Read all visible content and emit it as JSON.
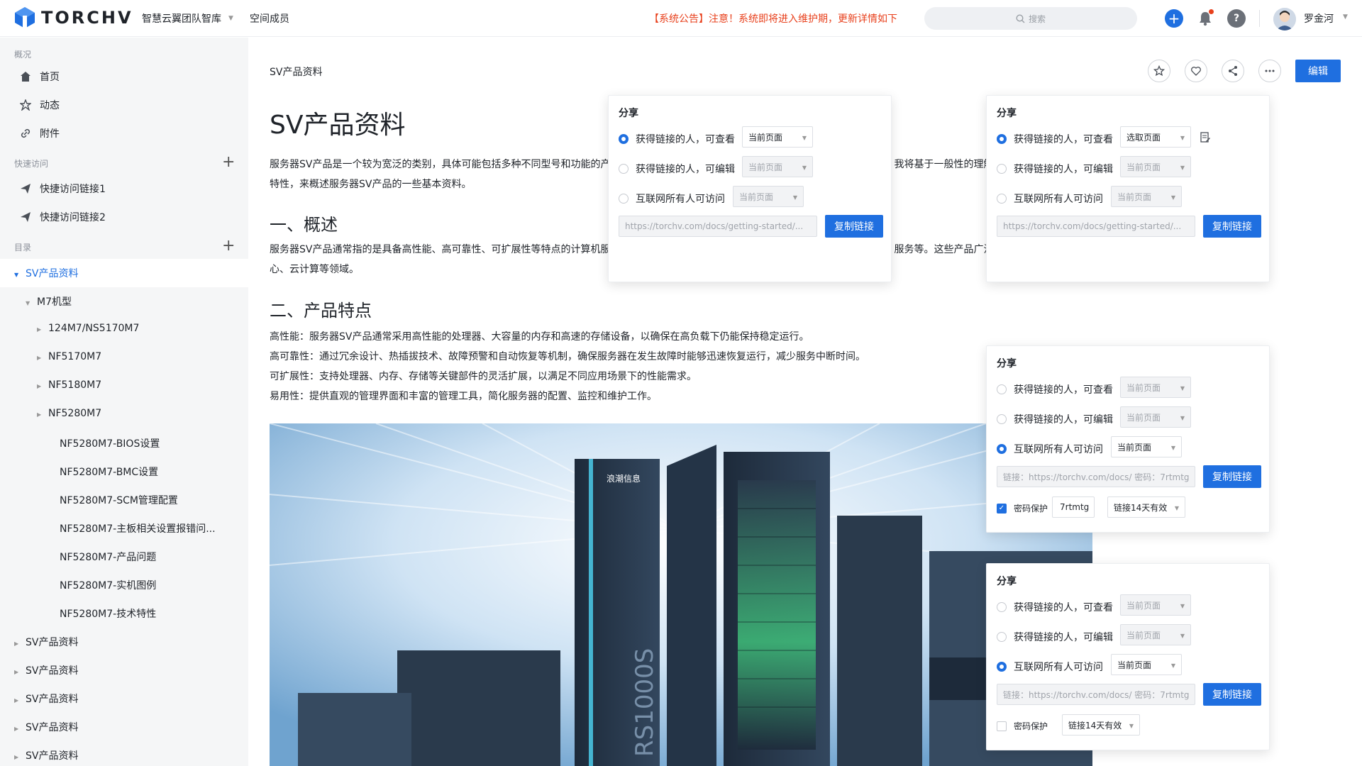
{
  "header": {
    "brand": "TORCHV",
    "team": "智慧云翼团队智库",
    "members": "空间成员",
    "notice_tag": "【系统公告】",
    "notice_text": "注意！系统即将进入维护期，更新详情如下",
    "search_placeholder": "搜索",
    "username": "罗金河",
    "help_glyph": "?",
    "plus_glyph": "+"
  },
  "sidebar": {
    "overview_title": "概况",
    "nav": [
      "首页",
      "动态",
      "附件"
    ],
    "quick_title": "快速访问",
    "quick": [
      "快捷访问链接1",
      "快捷访问链接2"
    ],
    "toc_title": "目录",
    "add_glyph": "+",
    "tree": [
      {
        "label": "SV产品资料"
      },
      {
        "label": "M7机型"
      },
      {
        "label": "124M7/NS5170M7"
      },
      {
        "label": "NF5170M7"
      },
      {
        "label": "NF5180M7"
      },
      {
        "label": "NF5280M7"
      },
      {
        "label": "NF5280M7-BIOS设置"
      },
      {
        "label": "NF5280M7-BMC设置"
      },
      {
        "label": "NF5280M7-SCM管理配置"
      },
      {
        "label": "NF5280M7-主板相关设置报错问..."
      },
      {
        "label": "NF5280M7-产品问题"
      },
      {
        "label": "NF5280M7-实机图例"
      },
      {
        "label": "NF5280M7-技术特性"
      },
      {
        "label": "SV产品资料"
      },
      {
        "label": "SV产品资料"
      },
      {
        "label": "SV产品资料"
      },
      {
        "label": "SV产品资料"
      },
      {
        "label": "SV产品资料"
      }
    ]
  },
  "doc": {
    "breadcrumb": "SV产品资料",
    "edit_label": "编辑",
    "title": "SV产品资料",
    "intro_1a": "服务器SV产品是一个较为宽泛的类别，具体可能包括多种不同型号和功能的产",
    "intro_1b": "我将基于一般性的理解",
    "intro_2": "特性，来概述服务器SV产品的一些基本资料。",
    "h_overview": "一、概述",
    "overview_1a": "服务器SV产品通常指的是具备高性能、高可靠性、可扩展性等特点的计算机服",
    "overview_1b": "服务等。这些产品广泛",
    "overview_2": "心、云计算等领域。",
    "h_features": "二、产品特点",
    "features": [
      "高性能：服务器SV产品通常采用高性能的处理器、大容量的内存和高速的存储设备，以确保在高负载下仍能保持稳定运行。",
      "高可靠性：通过冗余设计、热插拔技术、故障预警和自动恢复等机制，确保服务器在发生故障时能够迅速恢复运行，减少服务中断时间。",
      "可扩展性：支持处理器、内存、存储等关键部件的灵活扩展，以满足不同应用场景下的性能需求。",
      "易用性：提供直观的管理界面和丰富的管理工具，简化服务器的配置、监控和维护工作。"
    ],
    "hero_brand": "浪潮信息",
    "hero_model": "RS1000S"
  },
  "share": {
    "title": "分享",
    "opt_view": "获得链接的人，可查看",
    "opt_edit": "获得链接的人，可编辑",
    "opt_public": "互联网所有人可访问",
    "current_page": "当前页面",
    "select_page": "选取页面",
    "link_url": "https://torchv.com/docs/getting-started/...",
    "link_with_pwd": "链接：https://torchv.com/docs/ 密码：7rtmtg",
    "copy_label": "复制链接",
    "pwd_label": "密码保护",
    "pwd_value": "7rtmtg",
    "expiry": "链接14天有效"
  }
}
